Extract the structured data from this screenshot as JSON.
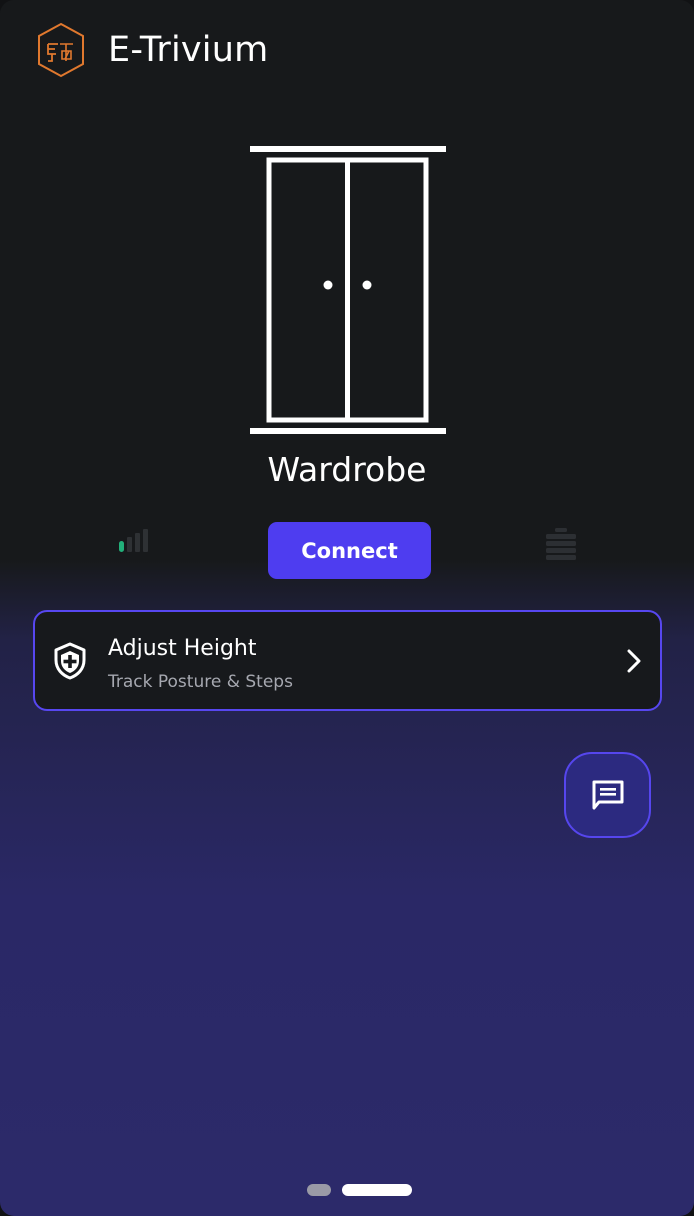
{
  "app": {
    "title": "E-Trivium",
    "logo_icon": "etrivium-hexagon-logo-icon"
  },
  "device": {
    "name": "Wardrobe",
    "icon": "wardrobe-icon",
    "signal_icon": "signal-strength-icon",
    "battery_icon": "battery-icon",
    "connect_label": "Connect"
  },
  "features": [
    {
      "title": "Adjust Height",
      "subtitle": "Track Posture & Steps",
      "icon": "shield-plus-icon"
    }
  ],
  "chat": {
    "icon": "chat-message-icon"
  },
  "pager": {
    "pages": 2,
    "active_index": 1
  },
  "colors": {
    "accent": "#4e3df0",
    "card_border": "#5747f0",
    "background_top": "#17191b",
    "background_bottom": "#2c2a6a",
    "signal_active": "#22b07a",
    "orange_logo": "#e0782e"
  }
}
